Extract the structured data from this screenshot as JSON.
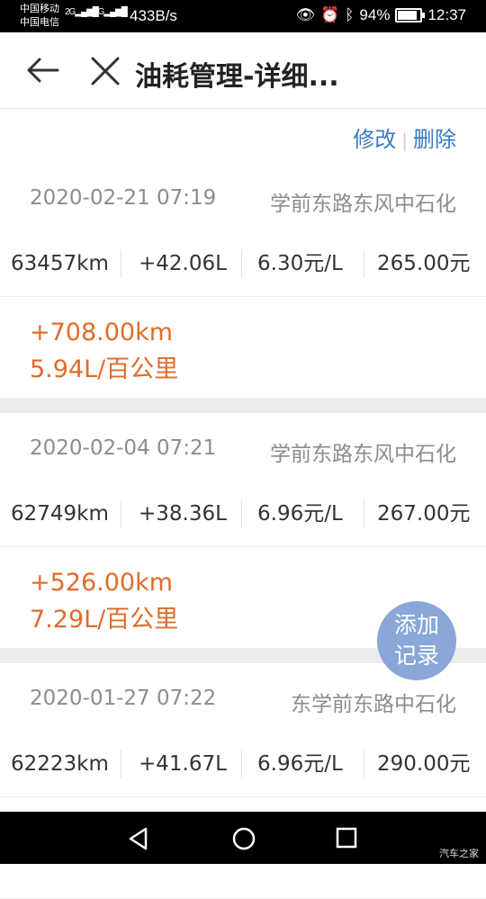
{
  "status_bar": {
    "carrier1": "中国移动",
    "carrier2": "中国电信",
    "sig1": "2G",
    "sig2": "4G",
    "net_speed": "433B/s",
    "battery": "94%",
    "battery_level": 0.94,
    "time": "12:37"
  },
  "header": {
    "title": "油耗管理-详细..."
  },
  "toolbar": {
    "edit": "修改",
    "separator": "|",
    "delete": "删除"
  },
  "records": [
    {
      "date": "2020-02-21 07:19",
      "station": "学前东路东风中石化",
      "odometer": "63457km",
      "fuel": "+42.06L",
      "price": "6.30元/L",
      "total": "265.00元",
      "distance": "+708.00km",
      "consumption": "5.94L/百公里"
    },
    {
      "date": "2020-02-04 07:21",
      "station": "学前东路东风中石化",
      "odometer": "62749km",
      "fuel": "+38.36L",
      "price": "6.96元/L",
      "total": "267.00元",
      "distance": "+526.00km",
      "consumption": "7.29L/百公里"
    },
    {
      "date": "2020-01-27 07:22",
      "station": "东学前东路中石化",
      "odometer": "62223km",
      "fuel": "+41.67L",
      "price": "6.96元/L",
      "total": "290.00元"
    }
  ],
  "add_button": {
    "line1": "添加",
    "line2": "记录"
  },
  "watermark": "汽车之家",
  "colors": {
    "link_blue": "#3a78c4",
    "accent_orange": "#e06c2a",
    "fab_blue": "#8aa7d9"
  }
}
